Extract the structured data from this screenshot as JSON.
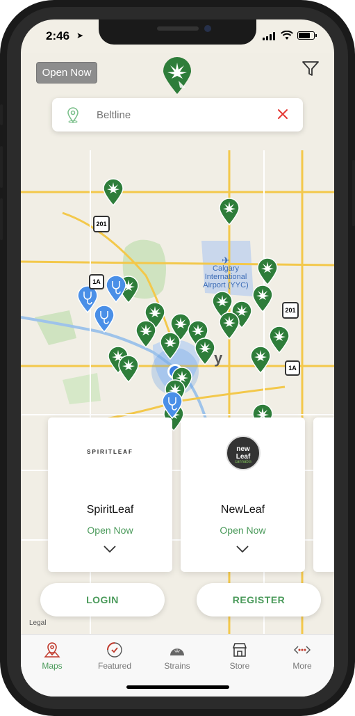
{
  "status_bar": {
    "time": "2:46",
    "signal_bars": 4,
    "battery_level_percent": 80
  },
  "header": {
    "open_now_label": "Open Now"
  },
  "search": {
    "placeholder": "Beltline"
  },
  "map": {
    "airport_label_line1": "Calgary",
    "airport_label_line2": "International",
    "airport_label_line3": "Airport (YYC)",
    "highway_201_a": "201",
    "highway_201_b": "201",
    "highway_1a_a": "1A",
    "highway_1a_b": "1A",
    "city_partial": "y",
    "legal_label": "Legal"
  },
  "cards": [
    {
      "name": "SpiritLeaf",
      "logo_text": "SPIRITLEAF",
      "status": "Open Now"
    },
    {
      "name": "NewLeaf",
      "logo_text_1": "new",
      "logo_text_2": "Leaf",
      "logo_text_3": "cannabis",
      "status": "Open Now"
    }
  ],
  "auth": {
    "login_label": "LOGIN",
    "register_label": "REGISTER"
  },
  "tabs": [
    {
      "label": "Maps",
      "icon": "map-pin-icon",
      "active": true
    },
    {
      "label": "Featured",
      "icon": "featured-badge-icon",
      "active": false
    },
    {
      "label": "Strains",
      "icon": "cannabis-leaf-icon",
      "active": false
    },
    {
      "label": "Store",
      "icon": "storefront-icon",
      "active": false
    },
    {
      "label": "More",
      "icon": "more-dots-icon",
      "active": false
    }
  ],
  "colors": {
    "brand_green": "#2e7d3a",
    "accent_green": "#4a9a5a",
    "clinic_blue": "#4a8fe7",
    "close_red": "#e53935"
  }
}
